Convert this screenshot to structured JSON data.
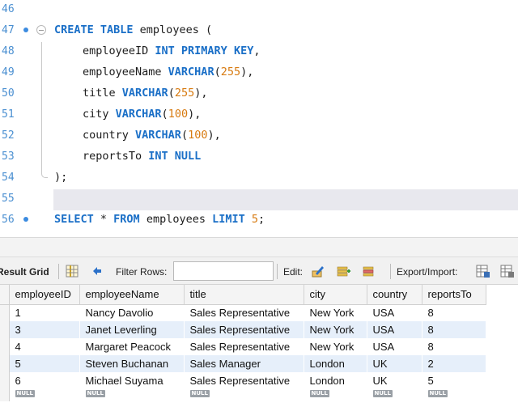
{
  "editor": {
    "lines": [
      {
        "num": "46",
        "tokens": []
      },
      {
        "num": "47",
        "tokens": [
          {
            "t": "kw",
            "v": "CREATE TABLE"
          },
          {
            "t": "tx",
            "v": " employees ("
          }
        ]
      },
      {
        "num": "48",
        "tokens": [
          {
            "t": "tx",
            "v": "employeeID "
          },
          {
            "t": "kw",
            "v": "INT PRIMARY KEY"
          },
          {
            "t": "tx",
            "v": ","
          }
        ]
      },
      {
        "num": "49",
        "tokens": [
          {
            "t": "tx",
            "v": "employeeName "
          },
          {
            "t": "kw",
            "v": "VARCHAR"
          },
          {
            "t": "tx",
            "v": "("
          },
          {
            "t": "num",
            "v": "255"
          },
          {
            "t": "tx",
            "v": "),"
          }
        ]
      },
      {
        "num": "50",
        "tokens": [
          {
            "t": "tx",
            "v": "title "
          },
          {
            "t": "kw",
            "v": "VARCHAR"
          },
          {
            "t": "tx",
            "v": "("
          },
          {
            "t": "num",
            "v": "255"
          },
          {
            "t": "tx",
            "v": "),"
          }
        ]
      },
      {
        "num": "51",
        "tokens": [
          {
            "t": "tx",
            "v": "city "
          },
          {
            "t": "kw",
            "v": "VARCHAR"
          },
          {
            "t": "tx",
            "v": "("
          },
          {
            "t": "num",
            "v": "100"
          },
          {
            "t": "tx",
            "v": "),"
          }
        ]
      },
      {
        "num": "52",
        "tokens": [
          {
            "t": "tx",
            "v": "country "
          },
          {
            "t": "kw",
            "v": "VARCHAR"
          },
          {
            "t": "tx",
            "v": "("
          },
          {
            "t": "num",
            "v": "100"
          },
          {
            "t": "tx",
            "v": "),"
          }
        ]
      },
      {
        "num": "53",
        "tokens": [
          {
            "t": "tx",
            "v": "reportsTo "
          },
          {
            "t": "kw",
            "v": "INT NULL"
          }
        ]
      },
      {
        "num": "54",
        "tokens": [
          {
            "t": "tx",
            "v": ");"
          }
        ]
      },
      {
        "num": "55",
        "tokens": []
      },
      {
        "num": "56",
        "tokens": [
          {
            "t": "kw",
            "v": "SELECT"
          },
          {
            "t": "tx",
            "v": " * "
          },
          {
            "t": "kw",
            "v": "FROM"
          },
          {
            "t": "tx",
            "v": " employees "
          },
          {
            "t": "kw",
            "v": "LIMIT"
          },
          {
            "t": "tx",
            "v": " "
          },
          {
            "t": "num",
            "v": "5"
          },
          {
            "t": "tx",
            "v": ";"
          }
        ]
      }
    ]
  },
  "toolbar": {
    "result_grid_label": "Result Grid",
    "filter_label": "Filter Rows:",
    "filter_value": "",
    "edit_label": "Edit:",
    "export_label": "Export/Import:"
  },
  "grid": {
    "columns": [
      "employeeID",
      "employeeName",
      "title",
      "city",
      "country",
      "reportsTo"
    ],
    "rows": [
      [
        "1",
        "Nancy Davolio",
        "Sales Representative",
        "New York",
        "USA",
        "8"
      ],
      [
        "3",
        "Janet Leverling",
        "Sales Representative",
        "New York",
        "USA",
        "8"
      ],
      [
        "4",
        "Margaret Peacock",
        "Sales Representative",
        "New York",
        "USA",
        "8"
      ],
      [
        "5",
        "Steven Buchanan",
        "Sales Manager",
        "London",
        "UK",
        "2"
      ],
      [
        "6",
        "Michael Suyama",
        "Sales Representative",
        "London",
        "UK",
        "5"
      ]
    ],
    "null_label": "NULL"
  },
  "colors": {
    "keyword": "#1a6fc7",
    "number": "#d77a10",
    "line_number": "#4a8fd1",
    "row_alt": "#e6effa"
  }
}
